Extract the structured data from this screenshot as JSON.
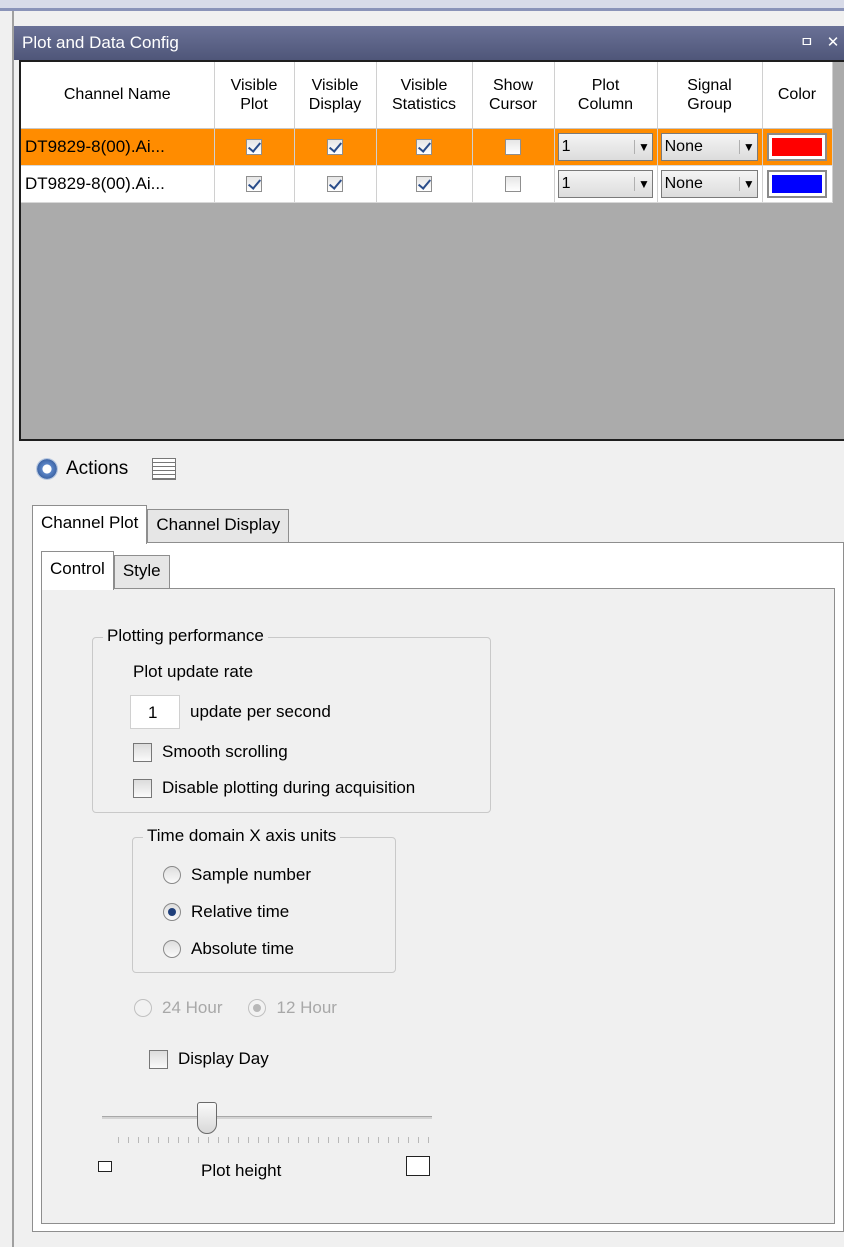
{
  "panel": {
    "title": "Plot and Data Config",
    "pin_glyph": "ㅁ",
    "close_glyph": "✕"
  },
  "grid": {
    "columns": [
      {
        "key": "channel_name",
        "label": "Channel Name"
      },
      {
        "key": "visible_plot",
        "label": "Visible\nPlot"
      },
      {
        "key": "visible_display",
        "label": "Visible\nDisplay"
      },
      {
        "key": "visible_statistics",
        "label": "Visible\nStatistics"
      },
      {
        "key": "show_cursor",
        "label": "Show\nCursor"
      },
      {
        "key": "plot_column",
        "label": "Plot\nColumn"
      },
      {
        "key": "signal_group",
        "label": "Signal\nGroup"
      },
      {
        "key": "color",
        "label": "Color"
      }
    ],
    "rows": [
      {
        "channel_name": "DT9829-8(00).Ai...",
        "visible_plot": true,
        "visible_display": true,
        "visible_statistics": true,
        "show_cursor": false,
        "plot_column": "1",
        "signal_group": "None",
        "color": "#ff0000",
        "selected": true
      },
      {
        "channel_name": "DT9829-8(00).Ai...",
        "visible_plot": true,
        "visible_display": true,
        "visible_statistics": true,
        "show_cursor": false,
        "plot_column": "1",
        "signal_group": "None",
        "color": "#0000ff",
        "selected": false
      }
    ]
  },
  "actions": {
    "label": "Actions"
  },
  "tabs": {
    "outer": [
      "Channel Plot",
      "Channel Display"
    ],
    "inner": [
      "Control",
      "Style"
    ]
  },
  "control": {
    "plotting_performance": {
      "legend": "Plotting performance",
      "update_rate_label": "Plot update rate",
      "update_rate_value": "1",
      "update_rate_unit": "update per second",
      "smooth_scrolling": {
        "label": "Smooth scrolling",
        "checked": false
      },
      "disable_plotting": {
        "label": "Disable plotting during acquisition",
        "checked": false
      }
    },
    "x_axis_units": {
      "legend": "Time domain X axis units",
      "options": [
        {
          "label": "Sample number",
          "selected": false
        },
        {
          "label": "Relative time",
          "selected": true
        },
        {
          "label": "Absolute time",
          "selected": false
        }
      ]
    },
    "hour_format": {
      "options": [
        {
          "label": "24 Hour",
          "selected": false
        },
        {
          "label": "12 Hour",
          "selected": true
        }
      ],
      "enabled": false
    },
    "display_day": {
      "label": "Display Day",
      "checked": false
    },
    "plot_height": {
      "label": "Plot height",
      "level": 0.25
    }
  },
  "colors": {
    "selected_row": "#ff8c00",
    "title_bar": "#5a6185",
    "grid_bg": "#ababab"
  }
}
